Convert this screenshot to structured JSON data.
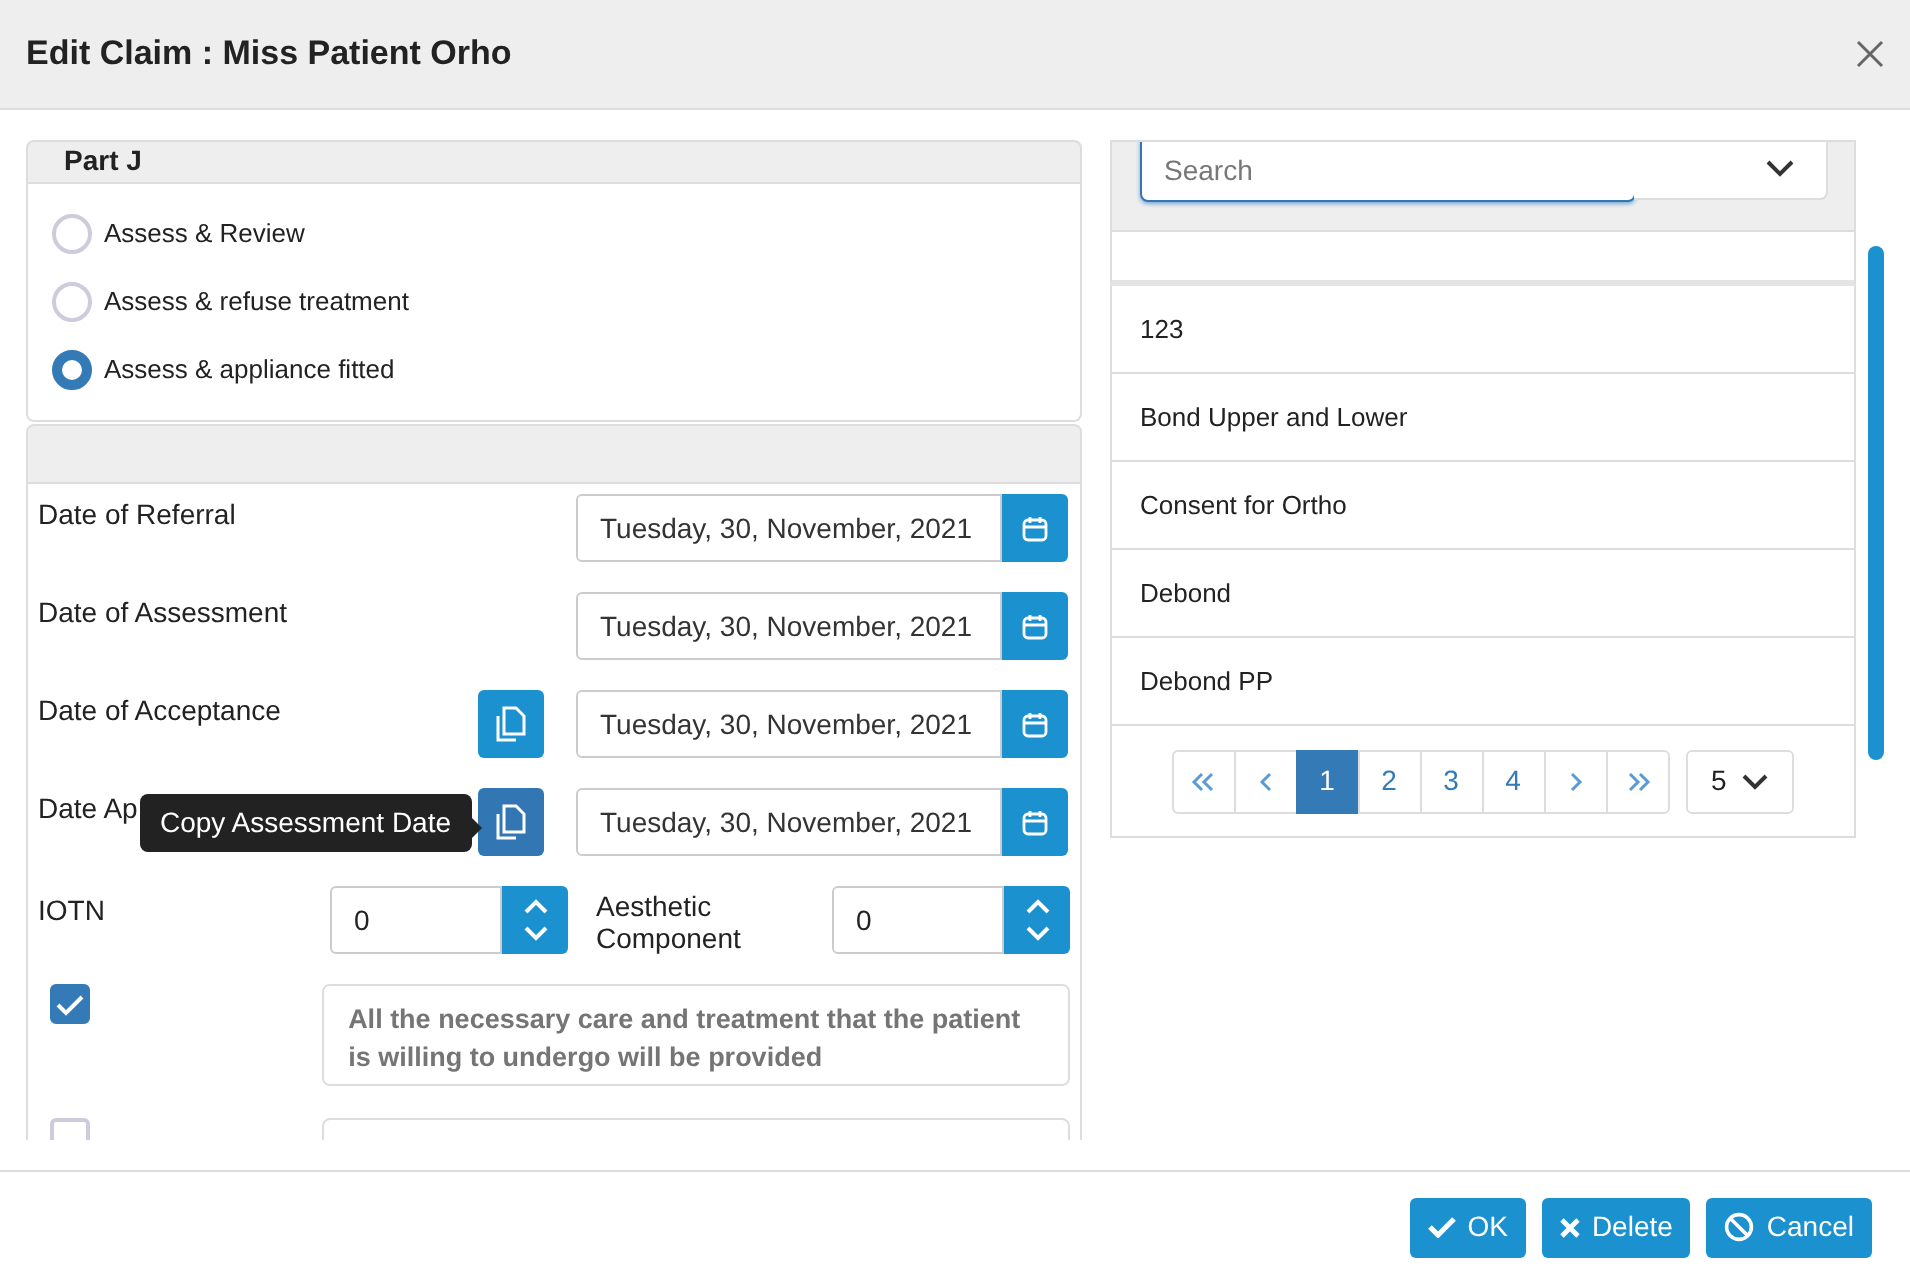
{
  "dialog": {
    "title": "Edit Claim : Miss Patient Orho"
  },
  "part": {
    "title": "Part J",
    "options": [
      {
        "label": "Assess & Review",
        "selected": false
      },
      {
        "label": "Assess & refuse treatment",
        "selected": false
      },
      {
        "label": "Assess & appliance fitted",
        "selected": true
      }
    ]
  },
  "dates": [
    {
      "label": "Date of Referral",
      "value": "Tuesday, 30, November, 2021",
      "copy_button": false
    },
    {
      "label": "Date of Assessment",
      "value": "Tuesday, 30, November, 2021",
      "copy_button": false
    },
    {
      "label": "Date of Acceptance",
      "value": "Tuesday, 30, November, 2021",
      "copy_button": true,
      "hovered": false
    },
    {
      "label": "Date Ap",
      "value": "Tuesday, 30, November, 2021",
      "copy_button": true,
      "hovered": true
    }
  ],
  "tooltip": {
    "text": "Copy Assessment Date"
  },
  "iotn": {
    "label": "IOTN",
    "value": "0"
  },
  "aesthetic": {
    "label": "Aesthetic Component",
    "value": "0"
  },
  "statements": [
    {
      "checked": true,
      "placeholder": "All the necessary care and treatment that the patient is willing to undergo will be provided"
    },
    {
      "checked": false
    }
  ],
  "picker": {
    "search_placeholder": "Search",
    "items": [
      "123",
      "Bond Upper and Lower",
      "Consent for Ortho",
      "Debond",
      "Debond PP"
    ],
    "pages": [
      {
        "label": "1",
        "selected": true
      },
      {
        "label": "2",
        "selected": false
      },
      {
        "label": "3",
        "selected": false
      },
      {
        "label": "4",
        "selected": false
      }
    ],
    "page_size": "5"
  },
  "buttons": [
    {
      "kind": "ok",
      "label": "OK"
    },
    {
      "kind": "delete",
      "label": "Delete"
    },
    {
      "kind": "cancel",
      "label": "Cancel"
    }
  ]
}
